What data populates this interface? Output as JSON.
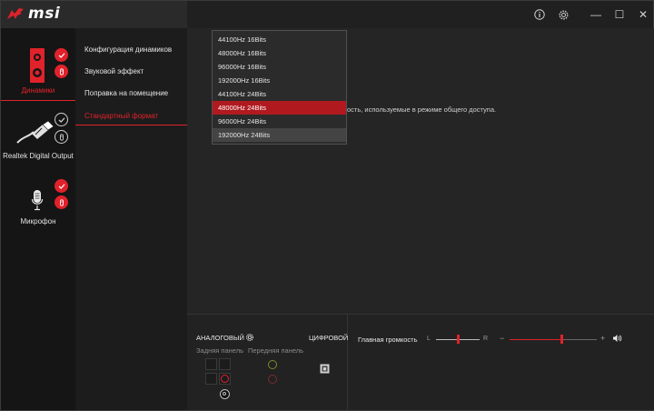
{
  "app": {
    "logo_text": "msi"
  },
  "titlebar": {
    "info_icon": "info-icon",
    "settings_icon": "gear-icon",
    "minimize_glyph": "—",
    "maximize_glyph": "☐",
    "close_glyph": "✕"
  },
  "devices": [
    {
      "label": "Динамики",
      "active": true,
      "icon": "speaker-icon"
    },
    {
      "label": "Realtek Digital Output",
      "active": false,
      "icon": "optical-cable-icon"
    },
    {
      "label": "Микрофон",
      "active": false,
      "icon": "microphone-icon"
    }
  ],
  "submenu": {
    "items": [
      {
        "label": "Конфигурация динамиков",
        "active": false
      },
      {
        "label": "Звуковой эффект",
        "active": false
      },
      {
        "label": "Поправка на помещение",
        "active": false
      },
      {
        "label": "Стандартный формат",
        "active": true
      }
    ]
  },
  "main": {
    "description_visible": "ость, используемые в режиме общего доступа."
  },
  "format_dropdown": {
    "options": [
      "44100Hz 16Bits",
      "48000Hz 16Bits",
      "96000Hz 16Bits",
      "192000Hz 16Bits",
      "44100Hz 24Bits",
      "48000Hz 24Bits",
      "96000Hz 24Bits",
      "192000Hz 24Bits"
    ],
    "selected": "48000Hz 24Bits",
    "hovered": "192000Hz 24Bits"
  },
  "bottom": {
    "analog_label": "АНАЛОГОВЫЙ",
    "digital_label": "ЦИФРОВОЙ",
    "rear_panel_label": "Задняя панель",
    "front_panel_label": "Передняя панель",
    "master_volume_label": "Главная громкость",
    "balance_left": "L",
    "balance_right": "R",
    "volume_minus": "−",
    "volume_plus": "+",
    "balance_level": 0.5,
    "volume_level": 0.6
  },
  "colors": {
    "accent": "#e0222b",
    "dropdown_selected": "#b01a1f"
  }
}
